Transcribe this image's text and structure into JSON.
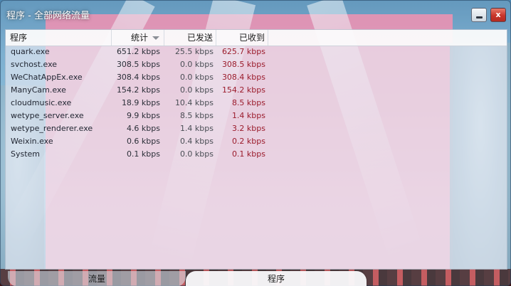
{
  "window": {
    "title": "程序 - 全部网络流量",
    "minimize_label": "",
    "close_label": "x"
  },
  "table": {
    "columns": {
      "name": "程序",
      "total": "统计",
      "sent": "已发送",
      "recv": "已收到"
    },
    "sort_column": "total",
    "sort_direction": "desc",
    "rows": [
      {
        "name": "quark.exe",
        "total": "651.2 kbps",
        "sent": "25.5 kbps",
        "recv": "625.7 kbps"
      },
      {
        "name": "svchost.exe",
        "total": "308.5 kbps",
        "sent": "0.0 kbps",
        "recv": "308.5 kbps"
      },
      {
        "name": "WeChatAppEx.exe",
        "total": "308.4 kbps",
        "sent": "0.0 kbps",
        "recv": "308.4 kbps"
      },
      {
        "name": "ManyCam.exe",
        "total": "154.2 kbps",
        "sent": "0.0 kbps",
        "recv": "154.2 kbps"
      },
      {
        "name": "cloudmusic.exe",
        "total": "18.9 kbps",
        "sent": "10.4 kbps",
        "recv": "8.5 kbps"
      },
      {
        "name": "wetype_server.exe",
        "total": "9.9 kbps",
        "sent": "8.5 kbps",
        "recv": "1.4 kbps"
      },
      {
        "name": "wetype_renderer.exe",
        "total": "4.6 kbps",
        "sent": "1.4 kbps",
        "recv": "3.2 kbps"
      },
      {
        "name": "Weixin.exe",
        "total": "0.6 kbps",
        "sent": "0.4 kbps",
        "recv": "0.2 kbps"
      },
      {
        "name": "System",
        "total": "0.1 kbps",
        "sent": "0.0 kbps",
        "recv": "0.1 kbps"
      }
    ]
  },
  "tabs": [
    {
      "label": "流量",
      "active": false
    },
    {
      "label": "程序",
      "active": true
    }
  ],
  "colors": {
    "recv_text": "#9b1c2c",
    "close_button": "#c8352a"
  }
}
